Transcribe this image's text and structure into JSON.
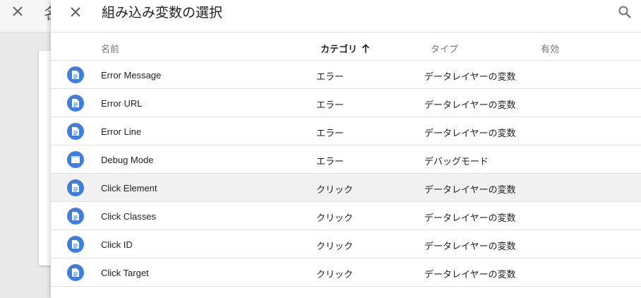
{
  "background": {
    "title_fragment": "名"
  },
  "header": {
    "title": "組み込み変数の選択"
  },
  "columns": {
    "name": "名前",
    "category": "カテゴリ",
    "type": "タイプ",
    "enabled": "有効"
  },
  "rows": [
    {
      "name": "Error Message",
      "category": "エラー",
      "type": "データレイヤーの変数",
      "icon": "document-icon"
    },
    {
      "name": "Error URL",
      "category": "エラー",
      "type": "データレイヤーの変数",
      "icon": "document-icon"
    },
    {
      "name": "Error Line",
      "category": "エラー",
      "type": "データレイヤーの変数",
      "icon": "document-icon"
    },
    {
      "name": "Debug Mode",
      "category": "エラー",
      "type": "デバッグモード",
      "icon": "window-icon"
    },
    {
      "name": "Click Element",
      "category": "クリック",
      "type": "データレイヤーの変数",
      "icon": "document-icon",
      "highlighted": true
    },
    {
      "name": "Click Classes",
      "category": "クリック",
      "type": "データレイヤーの変数",
      "icon": "document-icon"
    },
    {
      "name": "Click ID",
      "category": "クリック",
      "type": "データレイヤーの変数",
      "icon": "document-icon"
    },
    {
      "name": "Click Target",
      "category": "クリック",
      "type": "データレイヤーの変数",
      "icon": "document-icon"
    }
  ],
  "colors": {
    "accent_icon": "#3f7fd9",
    "highlight_row": "#f1f1f1"
  }
}
